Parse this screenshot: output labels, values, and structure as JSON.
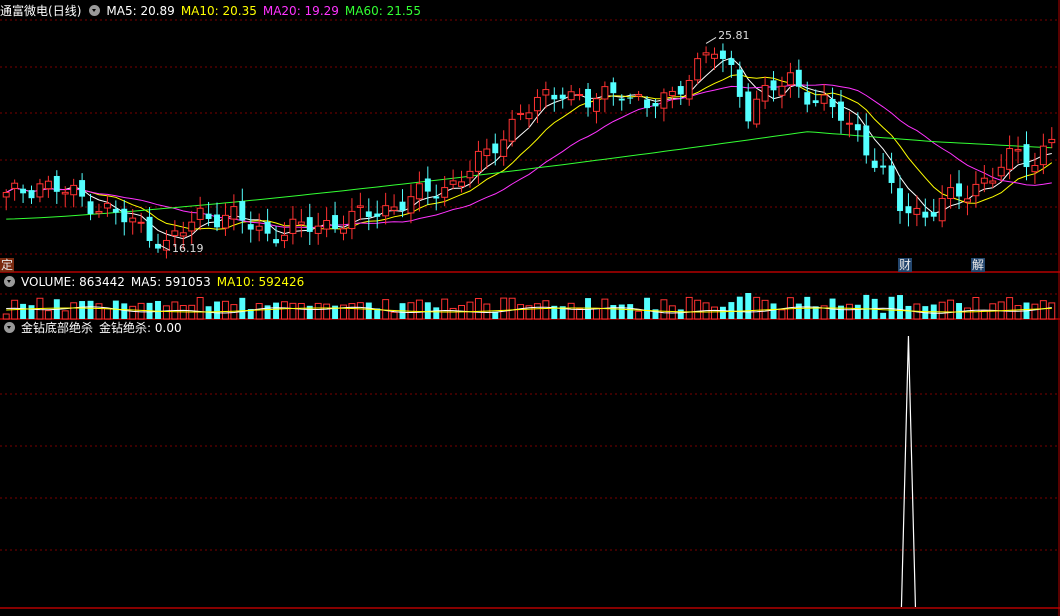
{
  "header": {
    "stock_name": "通富微电",
    "period": "(日线)",
    "ma_items": [
      {
        "label": "MA5: 20.89",
        "color": "#ffffff"
      },
      {
        "label": "MA10: 20.35",
        "color": "#ffff00"
      },
      {
        "label": "MA20: 19.29",
        "color": "#ff33ff"
      },
      {
        "label": "MA60: 21.55",
        "color": "#33ff33"
      }
    ]
  },
  "volume_header": {
    "items": [
      {
        "label": "VOLUME: 863442",
        "color": "#ffffff"
      },
      {
        "label": "MA5: 591053",
        "color": "#ffffff"
      },
      {
        "label": "MA10: 592426",
        "color": "#ffff00"
      }
    ]
  },
  "indicator_header": {
    "name": "金钻底部绝杀",
    "value_label": "金钻绝杀: 0.00"
  },
  "annotations": {
    "high_label": "25.81",
    "low_label": "16.19",
    "left_tag": "定",
    "event_tags": [
      "财",
      "解"
    ]
  },
  "colors": {
    "up": "#ff3232",
    "down": "#54ffff",
    "ma5": "#ffffff",
    "ma10": "#ffff00",
    "ma20": "#ff33ff",
    "ma60": "#33ff33",
    "separator": "#b40000",
    "grid": "#7a0000"
  },
  "chart_data": [
    {
      "type": "candlestick",
      "title": "通富微电 (日线)",
      "ylim": [
        15.3,
        27.5
      ],
      "count": 125,
      "extremes": {
        "high": 25.81,
        "low": 16.19
      },
      "last_close": 21.2,
      "ma": {
        "MA5": 20.89,
        "MA10": 20.35,
        "MA20": 19.29,
        "MA60": 21.55
      },
      "close_path": [
        [
          0,
          18.6
        ],
        [
          4,
          19.2
        ],
        [
          8,
          18.7
        ],
        [
          12,
          18.0
        ],
        [
          17,
          17.0
        ],
        [
          19,
          16.4
        ],
        [
          23,
          17.8
        ],
        [
          27,
          17.7
        ],
        [
          31,
          16.9
        ],
        [
          35,
          17.2
        ],
        [
          40,
          17.5
        ],
        [
          46,
          18.2
        ],
        [
          50,
          18.8
        ],
        [
          53,
          19.2
        ],
        [
          57,
          20.5
        ],
        [
          61,
          22.4
        ],
        [
          63,
          22.8
        ],
        [
          66,
          23.5
        ],
        [
          69,
          22.8
        ],
        [
          73,
          23.5
        ],
        [
          76,
          22.6
        ],
        [
          79,
          23.2
        ],
        [
          81,
          24.2
        ],
        [
          84,
          25.2
        ],
        [
          86,
          24.3
        ],
        [
          88,
          22.5
        ],
        [
          90,
          23.2
        ],
        [
          93,
          24.0
        ],
        [
          96,
          22.9
        ],
        [
          99,
          22.3
        ],
        [
          101,
          21.5
        ],
        [
          104,
          19.5
        ],
        [
          106,
          18.2
        ],
        [
          109,
          17.8
        ],
        [
          111,
          18.3
        ],
        [
          114,
          18.9
        ],
        [
          117,
          19.6
        ],
        [
          120,
          20.6
        ],
        [
          122,
          20.2
        ],
        [
          124,
          21.2
        ]
      ]
    },
    {
      "type": "bar",
      "title": "VOLUME",
      "count": 125,
      "ma": {
        "MA5": 591053,
        "MA10": 592426
      },
      "latest": 863442
    },
    {
      "type": "line",
      "title": "金钻底部绝杀",
      "series": [
        {
          "name": "金钻绝杀",
          "value": 0.0,
          "spike_index": 107,
          "spike_value": 1.0
        }
      ]
    }
  ]
}
